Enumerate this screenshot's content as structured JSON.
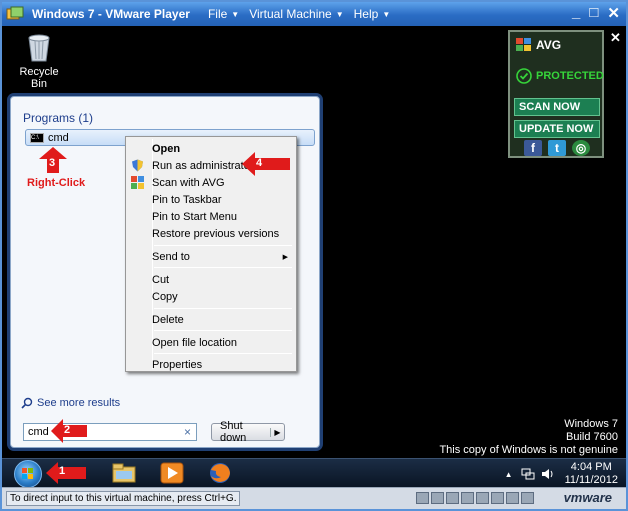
{
  "window": {
    "title": "Windows 7 - VMware Player",
    "menu": [
      "File",
      "Virtual Machine",
      "Help"
    ],
    "controls": [
      "_",
      "□",
      "✕"
    ]
  },
  "desktop": {
    "recycle_bin_label": "Recycle Bin",
    "genuine_lines": [
      "Windows 7",
      "Build 7600",
      "This copy of Windows is not genuine"
    ]
  },
  "start_menu": {
    "programs_header": "Programs (1)",
    "program_item": "cmd",
    "see_more": "See more results",
    "search_value": "cmd",
    "search_clear": "×",
    "shutdown_label": "Shut down",
    "shutdown_arrow": "▶"
  },
  "annotations": {
    "step1": "1",
    "step2": "2",
    "step3": "3",
    "step4": "4",
    "right_click_label": "Right-Click"
  },
  "context_menu": {
    "items": [
      {
        "label": "Open",
        "bold": true,
        "icon": ""
      },
      {
        "label": "Run as administrator",
        "icon": "shield-icon"
      },
      {
        "label": "Scan with AVG",
        "icon": "avg-icon"
      },
      {
        "label": "Pin to Taskbar"
      },
      {
        "label": "Pin to Start Menu"
      },
      {
        "label": "Restore previous versions"
      },
      {
        "label": "Send to",
        "submenu": true
      },
      {
        "label": "Cut"
      },
      {
        "label": "Copy"
      },
      {
        "label": "Delete"
      },
      {
        "label": "Open file location"
      },
      {
        "label": "Properties"
      }
    ],
    "submenu_glyph": "▶"
  },
  "avg": {
    "brand": "AVG",
    "close": "✕",
    "status": "PROTECTED",
    "scan_now": "SCAN NOW",
    "update_now": "UPDATE NOW",
    "social": [
      "f",
      "t",
      "◎"
    ],
    "colors": {
      "status": "#36d43a",
      "button": "#1c7f52"
    }
  },
  "taskbar": {
    "time": "4:04 PM",
    "date": "11/11/2012",
    "tray_arrow": "▲"
  },
  "statusbar": {
    "hint": "To direct input to this virtual machine, press Ctrl+G.",
    "vmware_logo": "vmware"
  },
  "colors": {
    "annotation_red": "#e01b1b",
    "titlebar_blue": "#2a6cc4"
  }
}
